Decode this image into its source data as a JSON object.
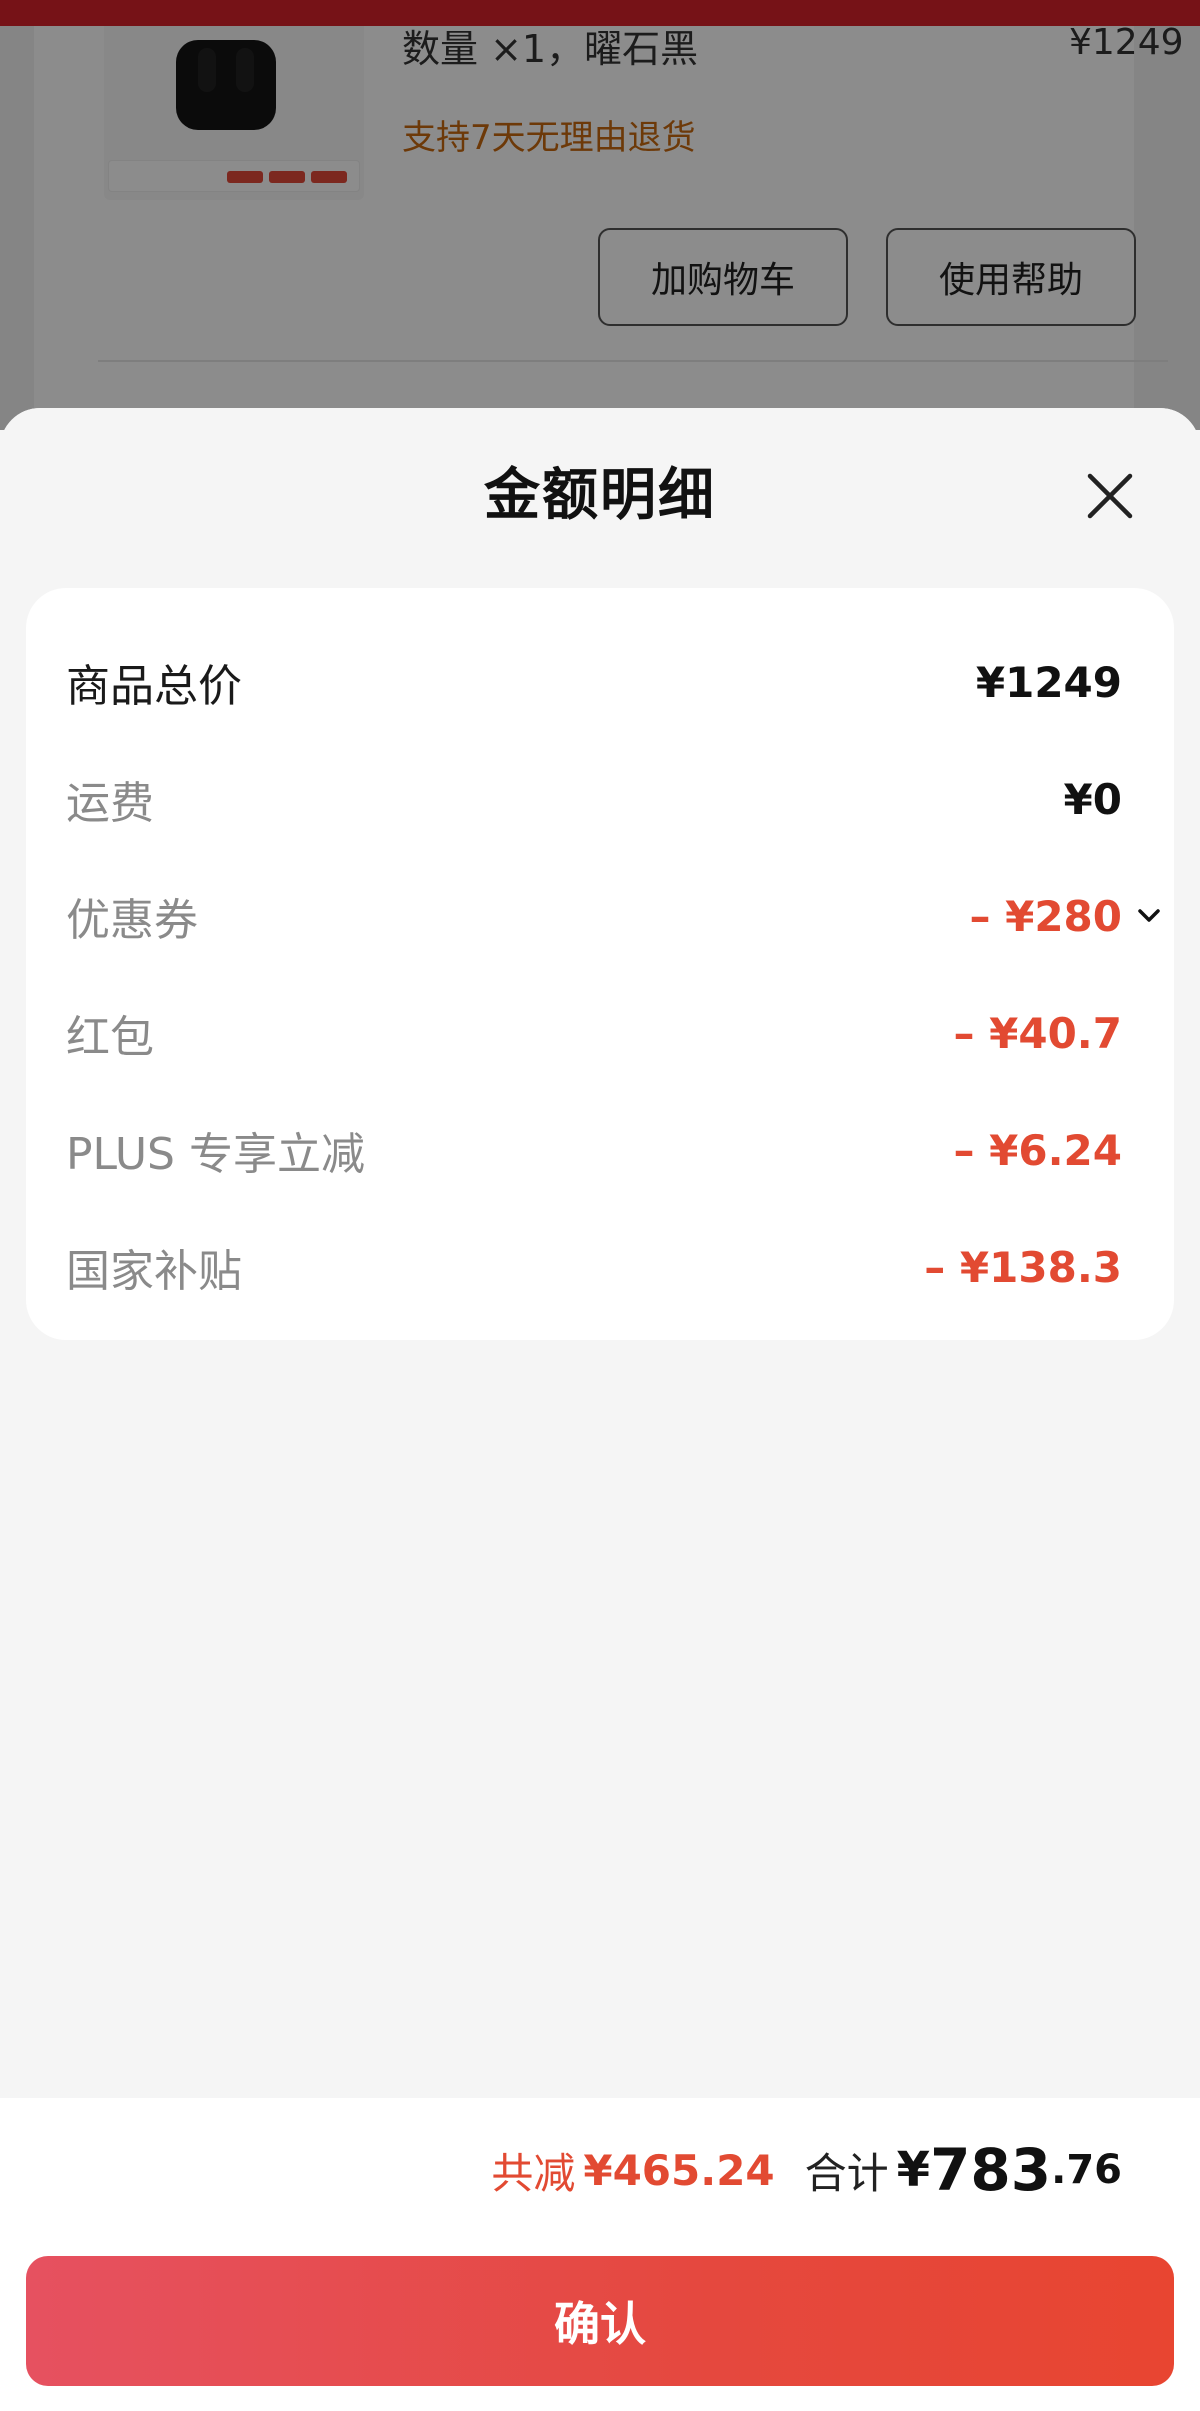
{
  "background_page": {
    "spec_text": "数量 ×1，曜石黑",
    "item_price": "¥1249",
    "return_policy": "支持7天无理由退货",
    "buttons": [
      "加购物车",
      "使用帮助"
    ]
  },
  "sheet": {
    "title": "金额明细",
    "close_icon": "close-icon"
  },
  "rows": [
    {
      "label": "商品总价",
      "value": "¥1249",
      "color": "#111111"
    },
    {
      "label": "运费",
      "value": "¥0",
      "color": "#111111"
    },
    {
      "label": "优惠券",
      "value": "– ¥280",
      "color": "#e24a32",
      "icon": "chevron-down-icon"
    },
    {
      "label": "红包",
      "value": "– ¥40.7",
      "color": "#e24a32"
    },
    {
      "label": "PLUS 专享立减",
      "value": "– ¥6.24",
      "color": "#e24a32"
    },
    {
      "label": "国家补贴",
      "value": "– ¥138.3",
      "color": "#e24a32"
    }
  ],
  "summary": {
    "save_label": "共减",
    "save_value": "¥465.24",
    "total_label": "合计",
    "total_yen": "¥",
    "total_int": "783",
    "total_dec": ".76"
  },
  "confirm_label": "确认",
  "colors": {
    "accent_red": "#e24a32",
    "confirm_gradient_start": "#e65160",
    "confirm_gradient_end": "#e84531"
  }
}
